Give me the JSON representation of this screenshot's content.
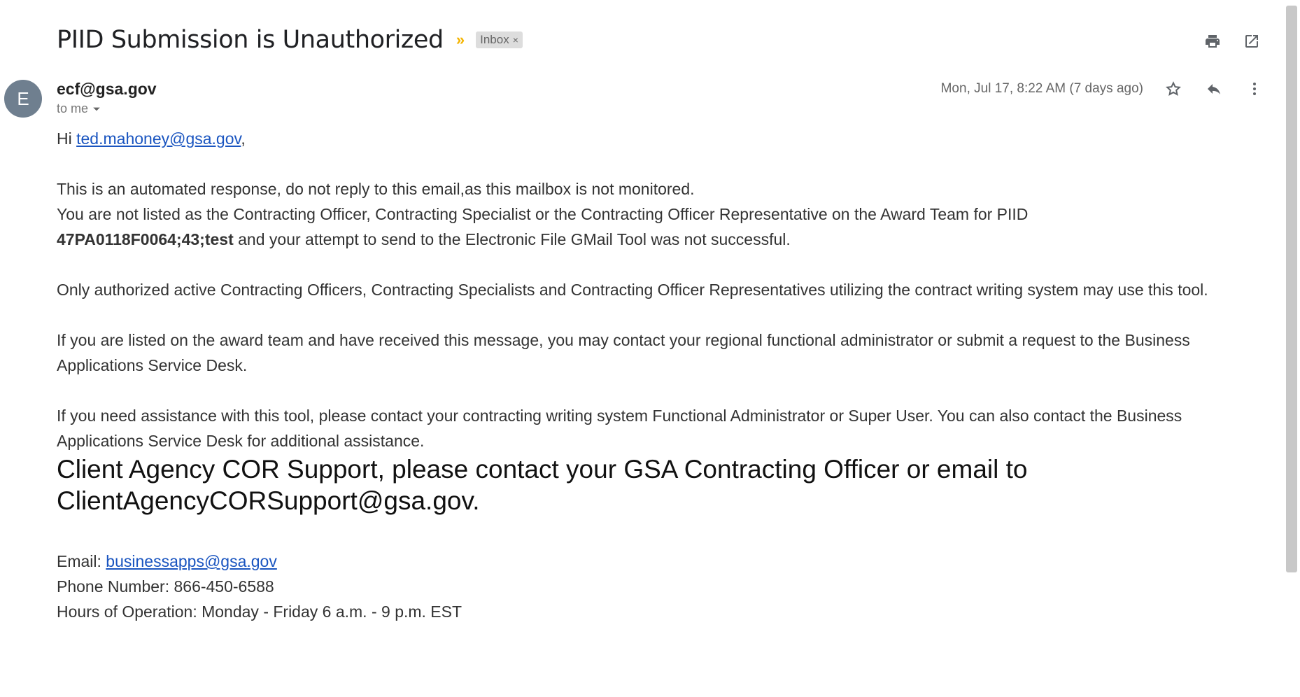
{
  "email": {
    "subject": "PIID Submission is Unauthorized",
    "label": "Inbox",
    "label_close": "×",
    "avatar_letter": "E",
    "sender": "ecf@gsa.gov",
    "recipient": "to me",
    "date": "Mon, Jul 17, 8:22 AM (7 days ago)"
  },
  "icons": {
    "importance": "importance-marker-icon",
    "print": "print-icon",
    "open_new_window": "open-in-new-window-icon",
    "star": "star-icon",
    "reply": "reply-icon",
    "more": "more-vert-icon",
    "dropdown": "chevron-down-icon"
  },
  "body": {
    "greeting_prefix": "Hi ",
    "greeting_link": "ted.mahoney@gsa.gov",
    "greeting_suffix": ",",
    "para1_line1": "This is an automated response, do not reply to this email,as this mailbox is not monitored.",
    "para1_line2": "You are not listed as the Contracting Officer, Contracting Specialist or the Contracting Officer Representative on the Award Team for PIID",
    "piid": "47PA0118F0064;43;test",
    "para1_line3_rest": " and your attempt to send to the Electronic File GMail Tool was not successful.",
    "para2": "Only authorized active Contracting Officers, Contracting Specialists and Contracting Officer Representatives utilizing the contract writing system may use this tool.",
    "para3": "If you are listed on the award team and have received this message, you may contact your regional functional administrator or submit a request to the Business Applications Service Desk.",
    "para4": "If you need assistance with this tool, please contact your contracting writing system Functional Administrator or Super User. You can also contact the Business Applications Service Desk for additional assistance.",
    "cor_notice": "Client Agency COR Support, please contact your GSA Contracting Officer or email to ClientAgencyCORSupport@gsa.gov.",
    "email_label": "Email: ",
    "email_link": "businessapps@gsa.gov",
    "phone": "Phone Number: 866-450-6588",
    "hours": "Hours of Operation: Monday - Friday 6 a.m. - 9 p.m. EST"
  }
}
